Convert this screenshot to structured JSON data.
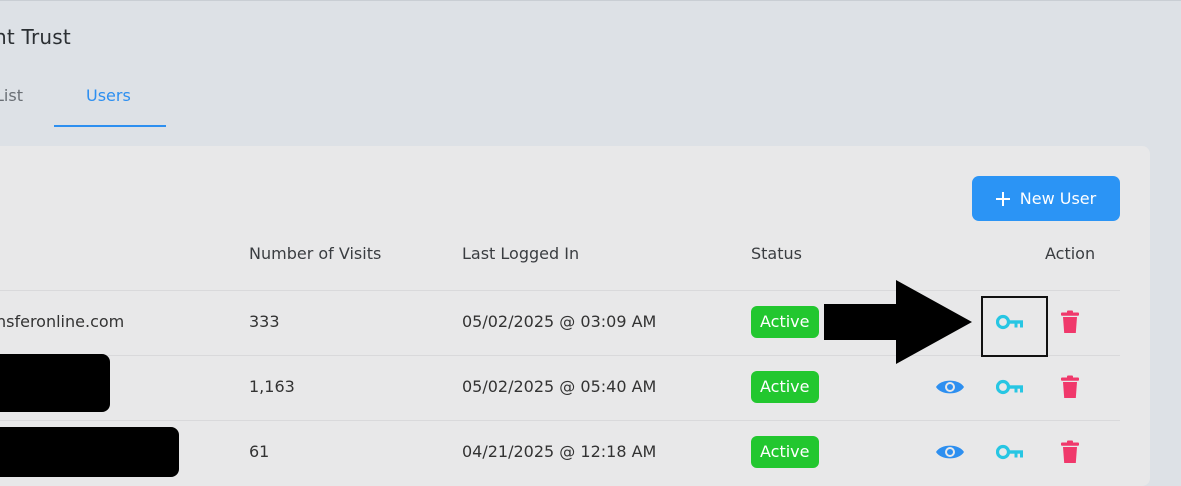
{
  "header": {
    "title": "nt Trust"
  },
  "tabs": [
    {
      "label": "List"
    },
    {
      "label": "Users"
    }
  ],
  "toolbar": {
    "new_user_label": "New User"
  },
  "table": {
    "columns": [
      "Number of Visits",
      "Last Logged In",
      "Status",
      "Action"
    ],
    "rows": [
      {
        "email": "nsferonline.com",
        "visits": "333",
        "last_login": "05/02/2025 @ 03:09 AM",
        "status": "Active"
      },
      {
        "email": "",
        "visits": "1,163",
        "last_login": "05/02/2025 @ 05:40 AM",
        "status": "Active"
      },
      {
        "email": "",
        "visits": "61",
        "last_login": "04/21/2025 @ 12:18 AM",
        "status": "Active"
      }
    ]
  },
  "icons": {
    "view": "eye-icon",
    "password": "key-icon",
    "delete": "trash-icon"
  },
  "colors": {
    "accent": "#2b94f5",
    "status_active": "#22c72f",
    "eye": "#2d8ff0",
    "key": "#27c6e3",
    "trash": "#f0386b"
  }
}
